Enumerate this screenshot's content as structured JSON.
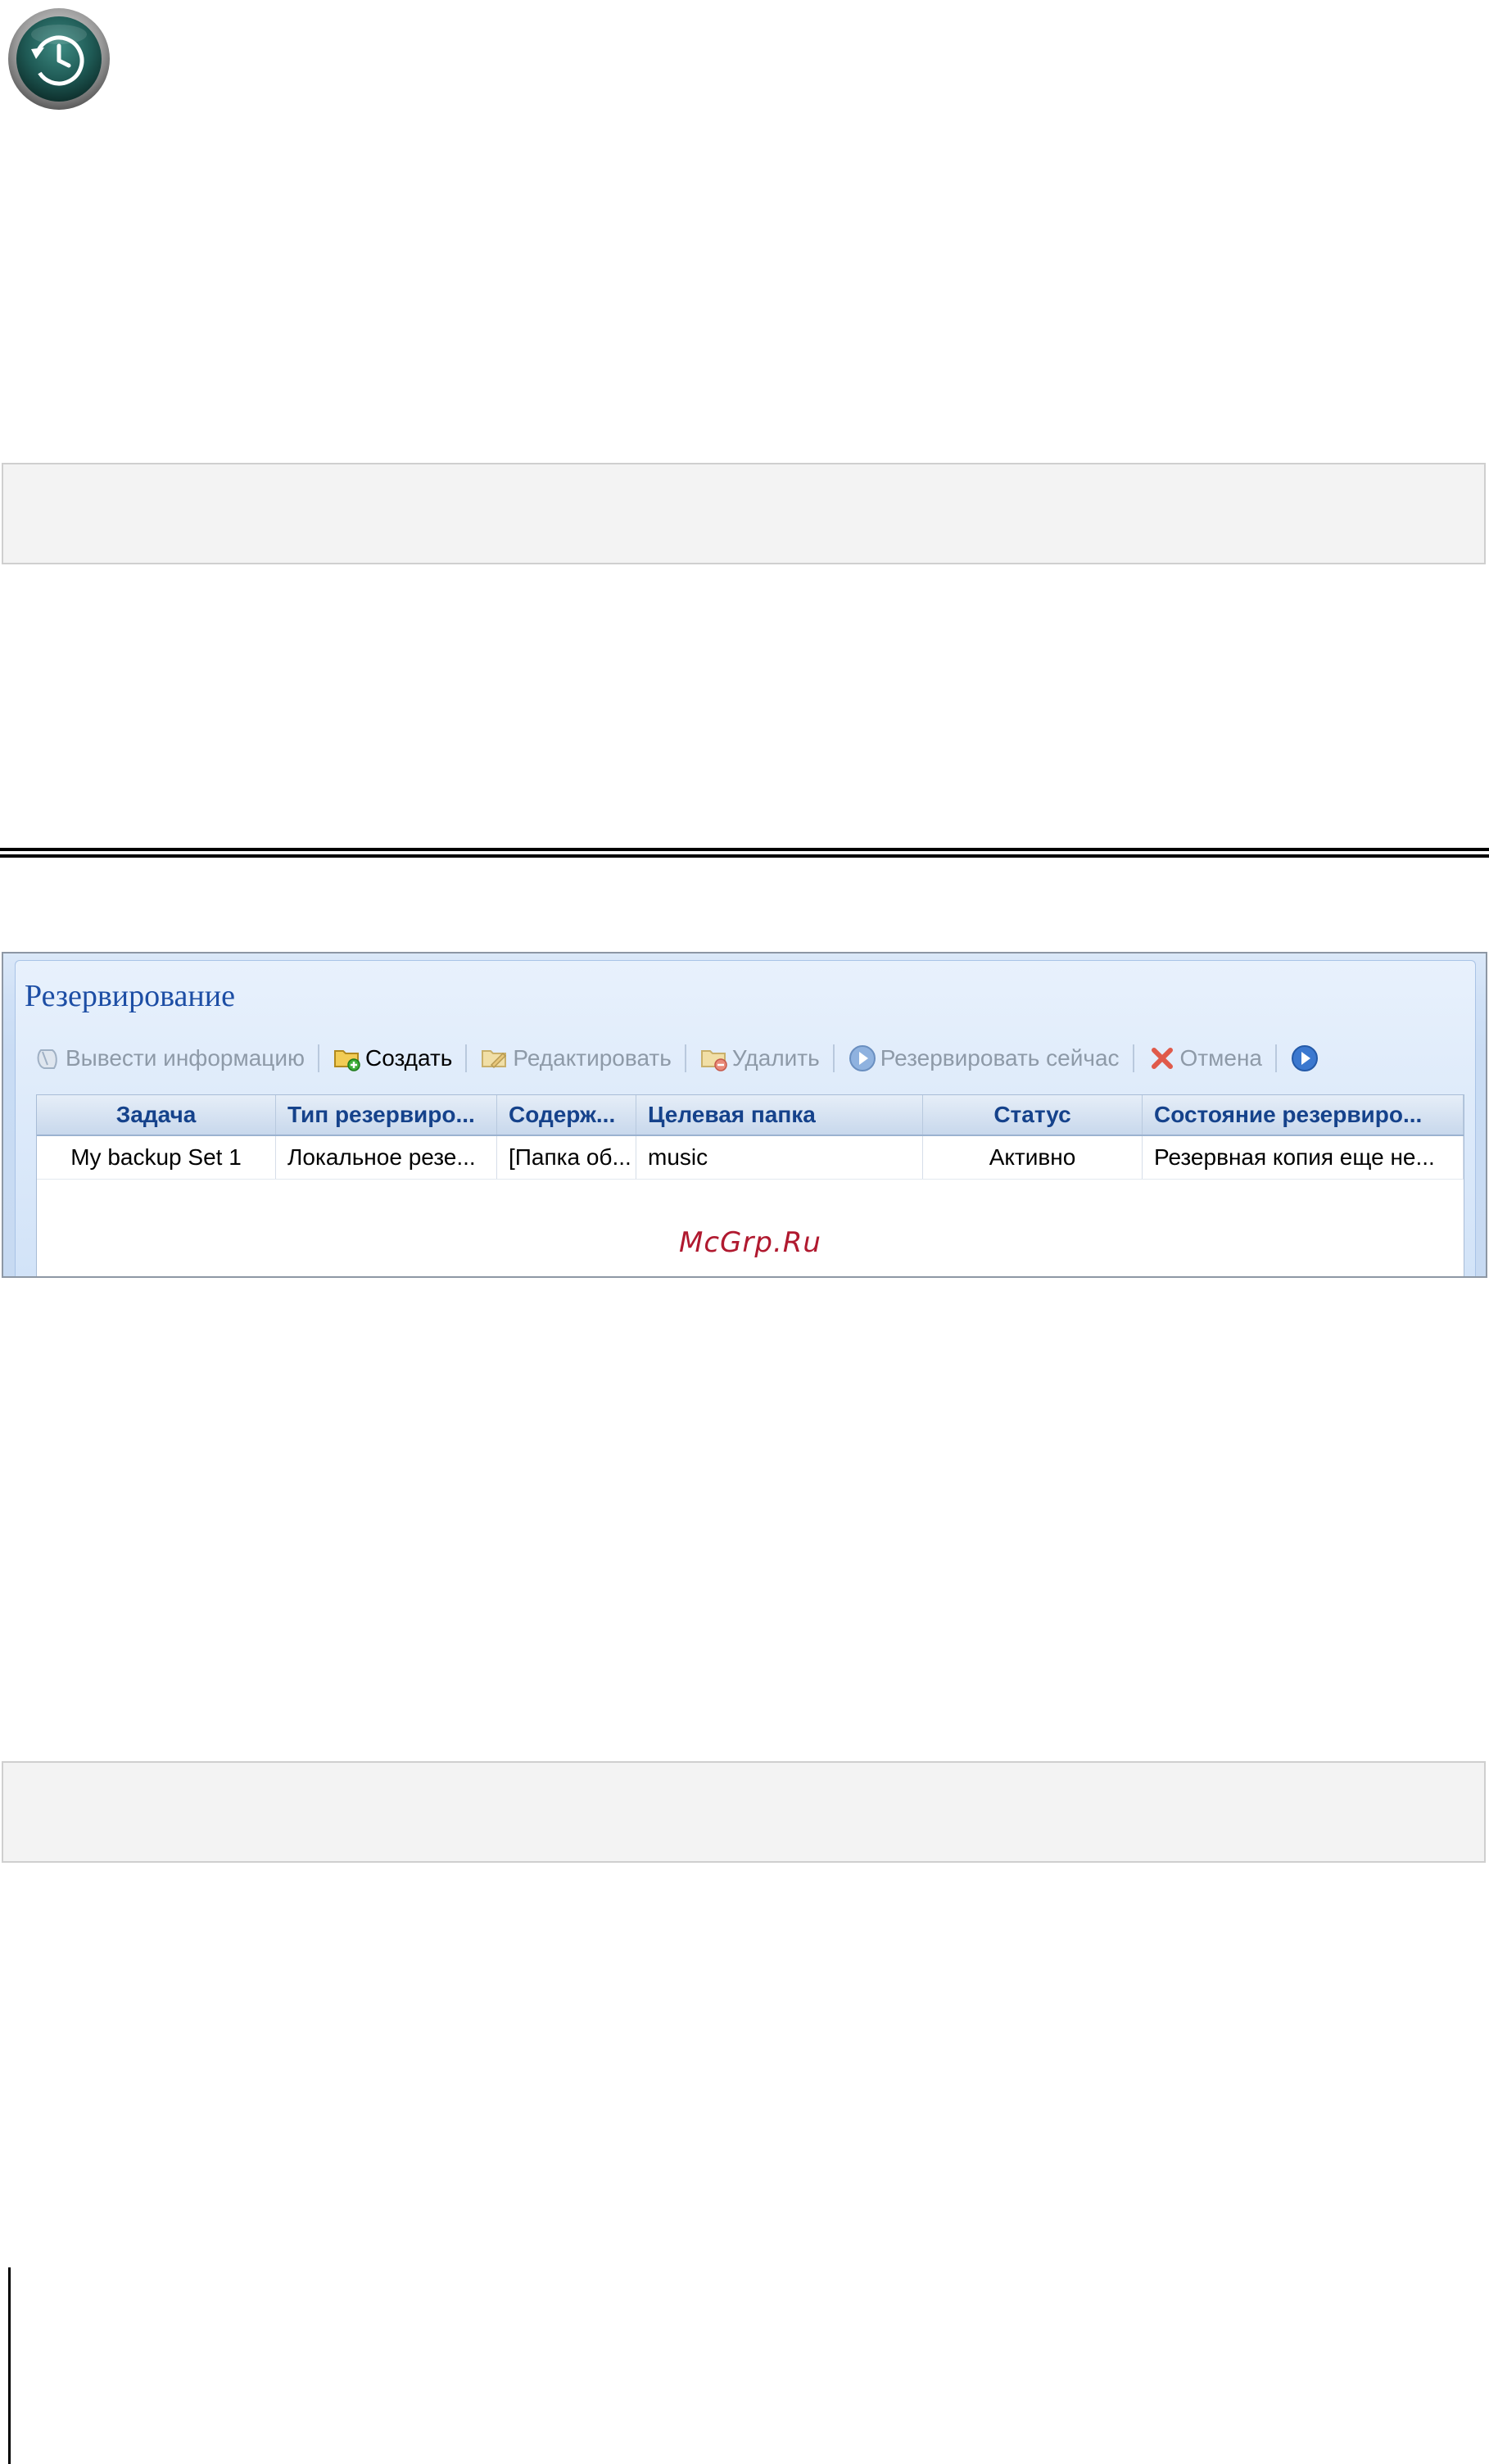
{
  "panel": {
    "title": "Резервирование",
    "toolbar": [
      {
        "label": "Вывести информацию",
        "icon": "info-icon",
        "enabled": false
      },
      {
        "label": "Создать",
        "icon": "folder-add-icon",
        "enabled": true
      },
      {
        "label": "Редактировать",
        "icon": "folder-edit-icon",
        "enabled": false
      },
      {
        "label": "Удалить",
        "icon": "folder-delete-icon",
        "enabled": false
      },
      {
        "label": "Резервировать сейчас",
        "icon": "play-circle-icon",
        "enabled": false
      },
      {
        "label": "Отмена",
        "icon": "close-icon",
        "enabled": false
      }
    ],
    "columns": [
      "Задача",
      "Тип резервиро...",
      "Содерж...",
      "Целевая папка",
      "Статус",
      "Состояние резервиро..."
    ],
    "rows": [
      [
        "My backup Set 1",
        "Локальное резе...",
        "[Папка об...",
        "music",
        "Активно",
        "Резервная копия еще не..."
      ]
    ],
    "watermark": "McGrp.Ru"
  },
  "colors": {
    "title": "#1d4ea5",
    "header_text": "#15428b",
    "watermark": "#b0192f",
    "disabled_text": "#8e9aa8"
  }
}
